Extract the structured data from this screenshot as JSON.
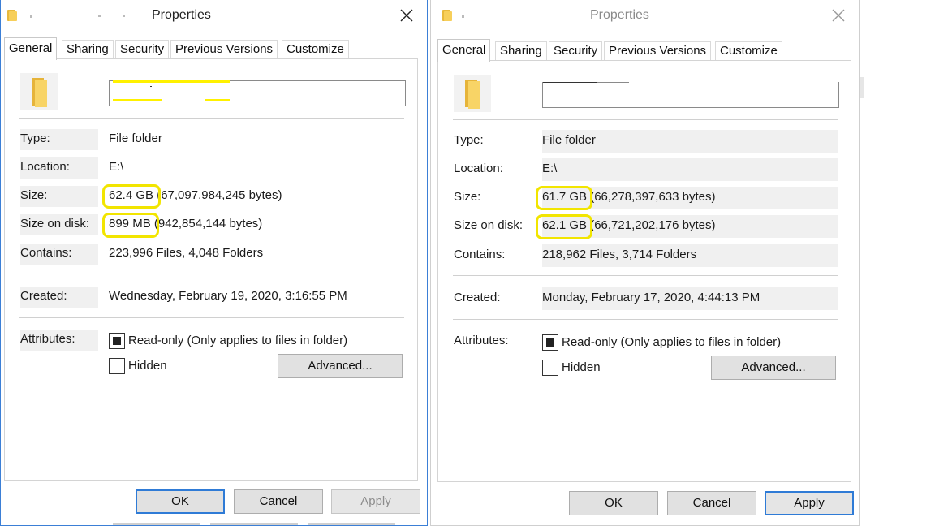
{
  "left": {
    "title": "Properties",
    "tabs": [
      "General",
      "Sharing",
      "Security",
      "Previous Versions",
      "Customize"
    ],
    "rows": {
      "type_label": "Type:",
      "type_value": "File folder",
      "location_label": "Location:",
      "location_value": "E:\\",
      "size_label": "Size:",
      "size_value": "62.4 GB (67,097,984,245 bytes)",
      "size_on_disk_label": "Size on disk:",
      "size_on_disk_value": "899 MB (942,854,144 bytes)",
      "contains_label": "Contains:",
      "contains_value": "223,996 Files, 4,048 Folders",
      "created_label": "Created:",
      "created_value": "Wednesday, February 19, 2020, 3:16:55 PM"
    },
    "attributes_label": "Attributes:",
    "readonly_label": "Read-only (Only applies to files in folder)",
    "hidden_label": "Hidden",
    "advanced_label": "Advanced...",
    "buttons": {
      "ok": "OK",
      "cancel": "Cancel",
      "apply": "Apply"
    }
  },
  "right": {
    "title": "Properties",
    "tabs": [
      "General",
      "Sharing",
      "Security",
      "Previous Versions",
      "Customize"
    ],
    "rows": {
      "type_label": "Type:",
      "type_value": "File folder",
      "location_label": "Location:",
      "location_value": "E:\\",
      "size_label": "Size:",
      "size_value": "61.7 GB (66,278,397,633 bytes)",
      "size_on_disk_label": "Size on disk:",
      "size_on_disk_value": "62.1 GB (66,721,202,176 bytes)",
      "contains_label": "Contains:",
      "contains_value": "218,962 Files, 3,714 Folders",
      "created_label": "Created:",
      "created_value": "Monday, February 17, 2020, 4:44:13 PM"
    },
    "attributes_label": "Attributes:",
    "readonly_label": "Read-only (Only applies to files in folder)",
    "hidden_label": "Hidden",
    "advanced_label": "Advanced...",
    "buttons": {
      "ok": "OK",
      "cancel": "Cancel",
      "apply": "Apply"
    }
  },
  "colors": {
    "highlight": "#f2e500",
    "focus_blue": "#2f7bd6",
    "folder": "#f8d466"
  }
}
